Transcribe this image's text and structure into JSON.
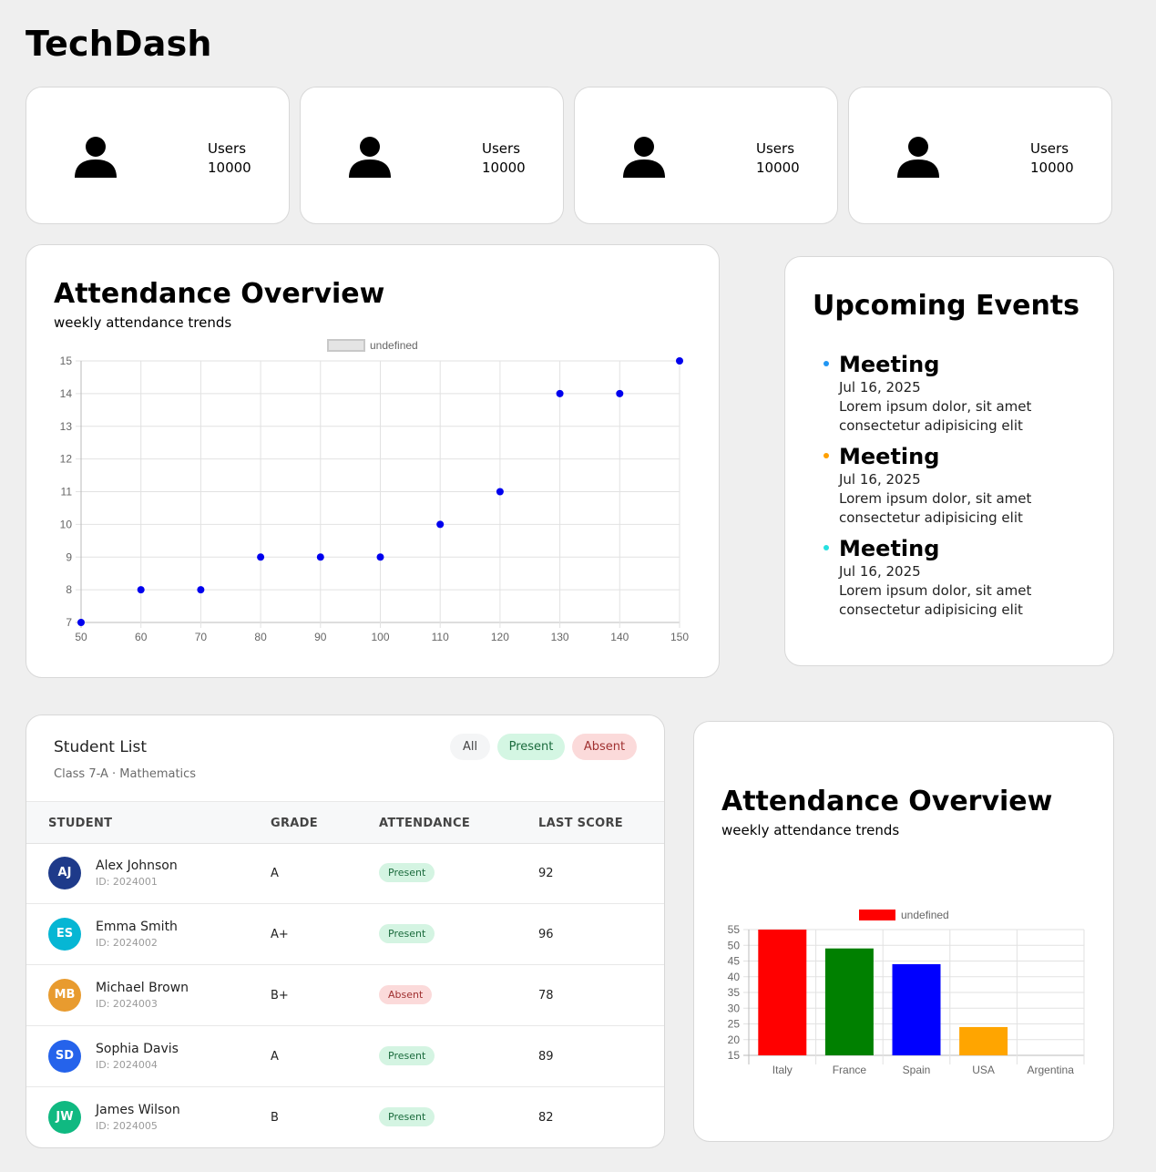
{
  "app": {
    "title": "TechDash"
  },
  "stats": [
    {
      "label": "Users",
      "value": "10000",
      "icon": "user-icon"
    },
    {
      "label": "Users",
      "value": "10000",
      "icon": "user-icon"
    },
    {
      "label": "Users",
      "value": "10000",
      "icon": "user-icon"
    },
    {
      "label": "Users",
      "value": "10000",
      "icon": "user-icon"
    }
  ],
  "attendance": {
    "title": "Attendance Overview",
    "subtitle": "weekly attendance trends"
  },
  "events": {
    "title": "Upcoming Events",
    "items": [
      {
        "title": "Meeting",
        "date": "Jul 16, 2025",
        "desc": "Lorem ipsum dolor, sit amet consectetur adipisicing elit",
        "color": "#2196f3"
      },
      {
        "title": "Meeting",
        "date": "Jul 16, 2025",
        "desc": "Lorem ipsum dolor, sit amet consectetur adipisicing elit",
        "color": "#ffa000"
      },
      {
        "title": "Meeting",
        "date": "Jul 16, 2025",
        "desc": "Lorem ipsum dolor, sit amet consectetur adipisicing elit",
        "color": "#26e0e0"
      }
    ]
  },
  "students": {
    "title": "Student List",
    "subtitle": "Class 7-A · Mathematics",
    "filters": {
      "all": "All",
      "present": "Present",
      "absent": "Absent"
    },
    "columns": [
      "STUDENT",
      "GRADE",
      "ATTENDANCE",
      "LAST SCORE"
    ],
    "rows": [
      {
        "initials": "AJ",
        "name": "Alex Johnson",
        "id": "ID: 2024001",
        "grade": "A",
        "attendance": "Present",
        "score": "92",
        "color": "#1e3a8a"
      },
      {
        "initials": "ES",
        "name": "Emma Smith",
        "id": "ID: 2024002",
        "grade": "A+",
        "attendance": "Present",
        "score": "96",
        "color": "#06b6d4"
      },
      {
        "initials": "MB",
        "name": "Michael Brown",
        "id": "ID: 2024003",
        "grade": "B+",
        "attendance": "Absent",
        "score": "78",
        "color": "#e89b2f"
      },
      {
        "initials": "SD",
        "name": "Sophia Davis",
        "id": "ID: 2024004",
        "grade": "A",
        "attendance": "Present",
        "score": "89",
        "color": "#2563eb"
      },
      {
        "initials": "JW",
        "name": "James Wilson",
        "id": "ID: 2024005",
        "grade": "B",
        "attendance": "Present",
        "score": "82",
        "color": "#10b981"
      }
    ]
  },
  "attendance2": {
    "title": "Attendance Overview",
    "subtitle": "weekly attendance trends"
  },
  "chart_data": [
    {
      "type": "scatter",
      "legend": "undefined",
      "legend_position": "top",
      "color": "#0000ee",
      "x": [
        50,
        60,
        70,
        80,
        90,
        100,
        110,
        120,
        130,
        140,
        150
      ],
      "y": [
        7,
        8,
        8,
        9,
        9,
        9,
        10,
        11,
        14,
        14,
        15
      ],
      "xlim": [
        50,
        150
      ],
      "ylim": [
        7,
        15
      ],
      "xticks": [
        50,
        60,
        70,
        80,
        90,
        100,
        110,
        120,
        130,
        140,
        150
      ],
      "yticks": [
        7,
        8,
        9,
        10,
        11,
        12,
        13,
        14,
        15
      ],
      "grid": true
    },
    {
      "type": "bar",
      "legend": "undefined",
      "legend_position": "top",
      "legend_color": "#ff0000",
      "categories": [
        "Italy",
        "France",
        "Spain",
        "USA",
        "Argentina"
      ],
      "values": [
        55,
        49,
        44,
        24,
        15
      ],
      "colors": [
        "#ff0000",
        "#008000",
        "#0000ff",
        "#ffa500",
        "#a52a2a"
      ],
      "ylim": [
        15,
        55
      ],
      "yticks": [
        15,
        20,
        25,
        30,
        35,
        40,
        45,
        50,
        55
      ],
      "grid": true
    }
  ]
}
